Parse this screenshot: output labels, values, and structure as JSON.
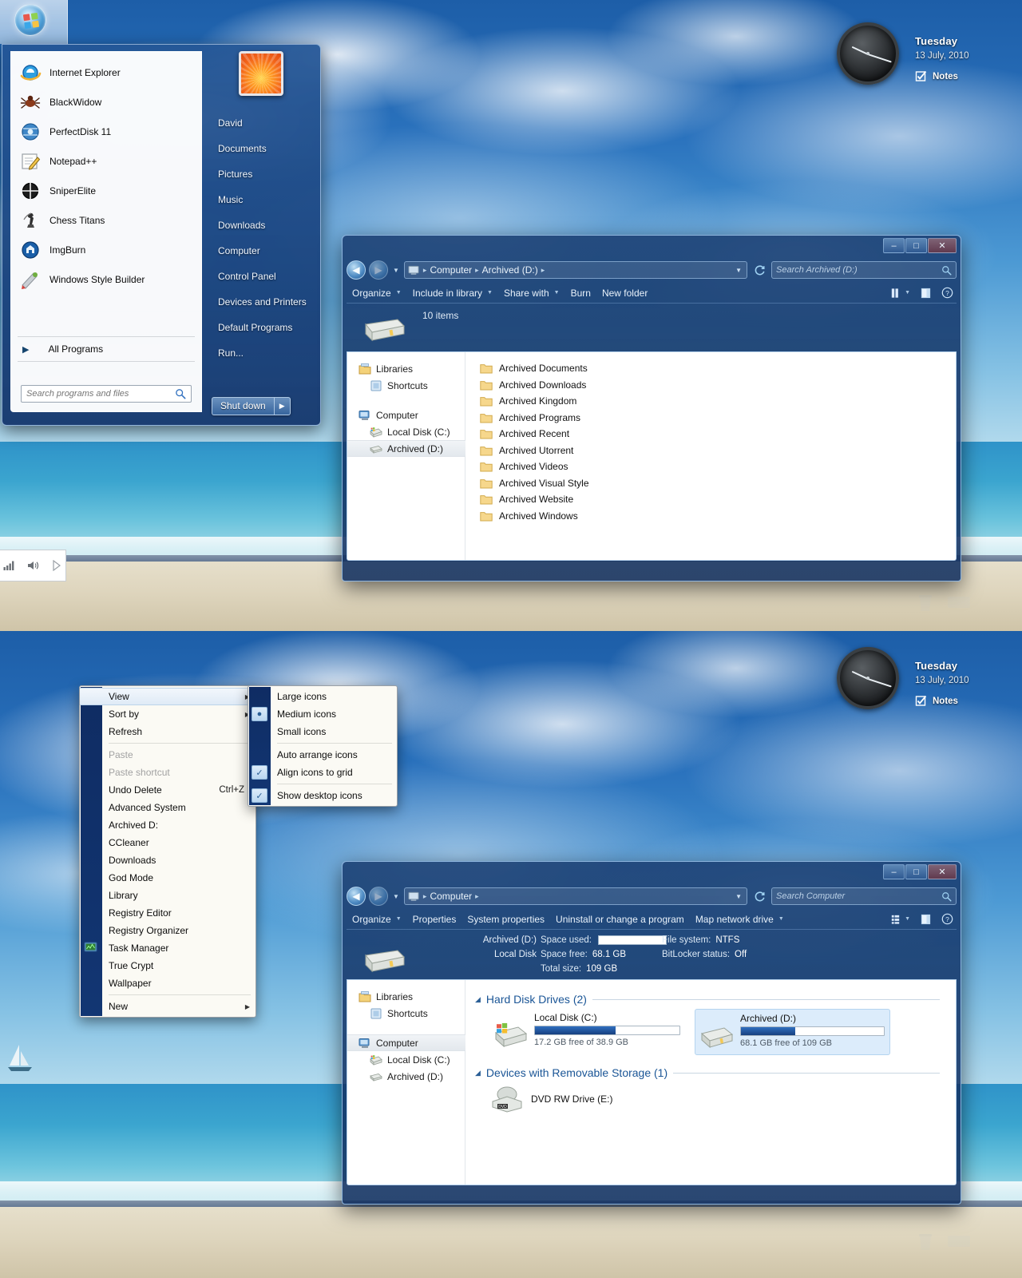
{
  "gadget": {
    "dayname": "Tuesday",
    "date": "13 July, 2010",
    "notes_label": "Notes",
    "notes_icon": "checklist-icon"
  },
  "start_menu": {
    "programs": [
      {
        "label": "Internet Explorer",
        "icon": "internet-explorer-icon"
      },
      {
        "label": "BlackWidow",
        "icon": "blackwidow-spider-icon"
      },
      {
        "label": "PerfectDisk 11",
        "icon": "perfectdisk-icon"
      },
      {
        "label": "Notepad++",
        "icon": "notepad-plus-plus-icon"
      },
      {
        "label": "SniperElite",
        "icon": "sniperelite-crosshair-icon"
      },
      {
        "label": "Chess Titans",
        "icon": "chess-titans-icon"
      },
      {
        "label": "ImgBurn",
        "icon": "imgburn-icon"
      },
      {
        "label": "Windows Style Builder",
        "icon": "windows-style-builder-icon"
      }
    ],
    "all_programs": "All Programs",
    "all_programs_arrow": "▶",
    "search_placeholder": "Search programs and files",
    "search_value": "",
    "user_name": "David",
    "right_links": [
      "Documents",
      "Pictures",
      "Music",
      "Downloads",
      "Computer",
      "Control Panel",
      "Devices and Printers",
      "Default Programs",
      "Run..."
    ],
    "shutdown_label": "Shut down",
    "shutdown_arrow": "▶"
  },
  "explorer_archived": {
    "window_title": "",
    "window_buttons": {
      "minimize": "–",
      "maximize": "□",
      "close": "✕"
    },
    "back_arrow": "◀",
    "forward_arrow": "▶",
    "breadcrumb": [
      "Computer",
      "Archived (D:)"
    ],
    "breadcrumb_sep": "▸",
    "search_placeholder": "Search Archived (D:)",
    "refresh_icon": "refresh-icon",
    "toolbar": [
      {
        "label": "Organize",
        "has_caret": true
      },
      {
        "label": "Include in library",
        "has_caret": true
      },
      {
        "label": "Share with",
        "has_caret": true
      },
      {
        "label": "Burn",
        "has_caret": false
      },
      {
        "label": "New folder",
        "has_caret": false
      }
    ],
    "toolbar_right": [
      "change-view-icon",
      "preview-pane-icon",
      "help-icon"
    ],
    "item_count": "10 items",
    "nav_pane": [
      {
        "label": "Libraries",
        "icon": "libraries-icon",
        "indent": false,
        "selected": false
      },
      {
        "label": "Shortcuts",
        "icon": "library-folder-icon",
        "indent": true,
        "selected": false
      },
      {
        "label": "Computer",
        "icon": "computer-icon",
        "indent": false,
        "selected": false
      },
      {
        "label": "Local Disk (C:)",
        "icon": "windows-drive-icon",
        "indent": true,
        "selected": false
      },
      {
        "label": "Archived (D:)",
        "icon": "hard-drive-icon",
        "indent": true,
        "selected": true
      }
    ],
    "files": [
      "Archived Documents",
      "Archived Downloads",
      "Archived Kingdom",
      "Archived Programs",
      "Archived Recent",
      "Archived Utorrent",
      "Archived Videos",
      "Archived Visual Style",
      "Archived Website",
      "Archived Windows"
    ]
  },
  "explorer_computer": {
    "window_buttons": {
      "minimize": "–",
      "maximize": "□",
      "close": "✕"
    },
    "back_arrow": "◀",
    "forward_arrow": "▶",
    "breadcrumb": [
      "Computer"
    ],
    "breadcrumb_sep": "▸",
    "search_placeholder": "Search Computer",
    "toolbar": [
      {
        "label": "Organize",
        "has_caret": true
      },
      {
        "label": "Properties",
        "has_caret": false
      },
      {
        "label": "System properties",
        "has_caret": false
      },
      {
        "label": "Uninstall or change a program",
        "has_caret": false
      },
      {
        "label": "Map network drive",
        "has_caret": true
      }
    ],
    "details": {
      "title": "Archived (D:)",
      "subtitle": "Local Disk",
      "space_used_label": "Space used:",
      "space_free_label": "Space free:",
      "space_free_value": "68.1 GB",
      "total_size_label": "Total size:",
      "total_size_value": "109 GB",
      "file_system_label": "File system:",
      "file_system_value": "NTFS",
      "bitlocker_label": "BitLocker status:",
      "bitlocker_value": "Off"
    },
    "nav_pane": [
      {
        "label": "Libraries",
        "icon": "libraries-icon",
        "indent": false,
        "selected": false
      },
      {
        "label": "Shortcuts",
        "icon": "library-folder-icon",
        "indent": true,
        "selected": false
      },
      {
        "label": "Computer",
        "icon": "computer-icon",
        "indent": false,
        "selected": true
      },
      {
        "label": "Local Disk (C:)",
        "icon": "windows-drive-icon",
        "indent": true,
        "selected": false
      },
      {
        "label": "Archived (D:)",
        "icon": "hard-drive-icon",
        "indent": true,
        "selected": false
      }
    ],
    "groups": [
      {
        "title": "Hard Disk Drives (2)",
        "collapse_icon": "◢",
        "drives": [
          {
            "name": "Local Disk (C:)",
            "free_text": "17.2 GB free of 38.9 GB",
            "used_percent": 56,
            "icon": "windows-drive-icon",
            "selected": false
          },
          {
            "name": "Archived (D:)",
            "free_text": "68.1 GB free of 109 GB",
            "used_percent": 38,
            "icon": "hard-drive-icon",
            "selected": true
          }
        ]
      },
      {
        "title": "Devices with Removable Storage (1)",
        "collapse_icon": "◢",
        "devices": [
          {
            "name": "DVD RW Drive (E:)",
            "icon": "dvd-drive-icon"
          }
        ]
      }
    ]
  },
  "desktop_context_menu": {
    "items": [
      {
        "label": "View",
        "submenu": true,
        "disabled": false,
        "highlight": true,
        "accel": ""
      },
      {
        "label": "Sort by",
        "submenu": true,
        "disabled": false,
        "highlight": false,
        "accel": ""
      },
      {
        "label": "Refresh",
        "submenu": false,
        "disabled": false,
        "highlight": false,
        "accel": ""
      },
      {
        "sep": true
      },
      {
        "label": "Paste",
        "submenu": false,
        "disabled": true,
        "highlight": false,
        "accel": ""
      },
      {
        "label": "Paste shortcut",
        "submenu": false,
        "disabled": true,
        "highlight": false,
        "accel": ""
      },
      {
        "label": "Undo Delete",
        "submenu": false,
        "disabled": false,
        "highlight": false,
        "accel": "Ctrl+Z"
      },
      {
        "label": "Advanced System",
        "submenu": false,
        "disabled": false,
        "highlight": false,
        "accel": ""
      },
      {
        "label": "Archived D:",
        "submenu": false,
        "disabled": false,
        "highlight": false,
        "accel": ""
      },
      {
        "label": "CCleaner",
        "submenu": false,
        "disabled": false,
        "highlight": false,
        "accel": ""
      },
      {
        "label": "Downloads",
        "submenu": false,
        "disabled": false,
        "highlight": false,
        "accel": ""
      },
      {
        "label": "God Mode",
        "submenu": false,
        "disabled": false,
        "highlight": false,
        "accel": ""
      },
      {
        "label": "Library",
        "submenu": false,
        "disabled": false,
        "highlight": false,
        "accel": ""
      },
      {
        "label": "Registry Editor",
        "submenu": false,
        "disabled": false,
        "highlight": false,
        "accel": ""
      },
      {
        "label": "Registry Organizer",
        "submenu": false,
        "disabled": false,
        "highlight": false,
        "accel": ""
      },
      {
        "label": "Task Manager",
        "submenu": false,
        "disabled": false,
        "highlight": false,
        "accel": "",
        "icon": "task-manager-icon"
      },
      {
        "label": "True Crypt",
        "submenu": false,
        "disabled": false,
        "highlight": false,
        "accel": ""
      },
      {
        "label": "Wallpaper",
        "submenu": false,
        "disabled": false,
        "highlight": false,
        "accel": ""
      },
      {
        "sep": true
      },
      {
        "label": "New",
        "submenu": true,
        "disabled": false,
        "highlight": false,
        "accel": ""
      }
    ]
  },
  "view_submenu": {
    "items": [
      {
        "label": "Large icons",
        "checked": false,
        "radio": false
      },
      {
        "label": "Medium icons",
        "checked": false,
        "radio": true
      },
      {
        "label": "Small icons",
        "checked": false,
        "radio": false
      },
      {
        "sep": true
      },
      {
        "label": "Auto arrange icons",
        "checked": false,
        "radio": false
      },
      {
        "label": "Align icons to grid",
        "checked": true,
        "radio": false
      },
      {
        "sep": true
      },
      {
        "label": "Show desktop icons",
        "checked": true,
        "radio": false
      }
    ]
  },
  "tray_popup": {
    "icons": [
      "network-signal-icon",
      "volume-icon",
      "action-center-icon"
    ]
  },
  "colors": {
    "accent_blue": "#1a5596",
    "glass_blue": "#123673",
    "selection_blue": "#dcecfb",
    "folder_yellow": "#f3ce63"
  }
}
